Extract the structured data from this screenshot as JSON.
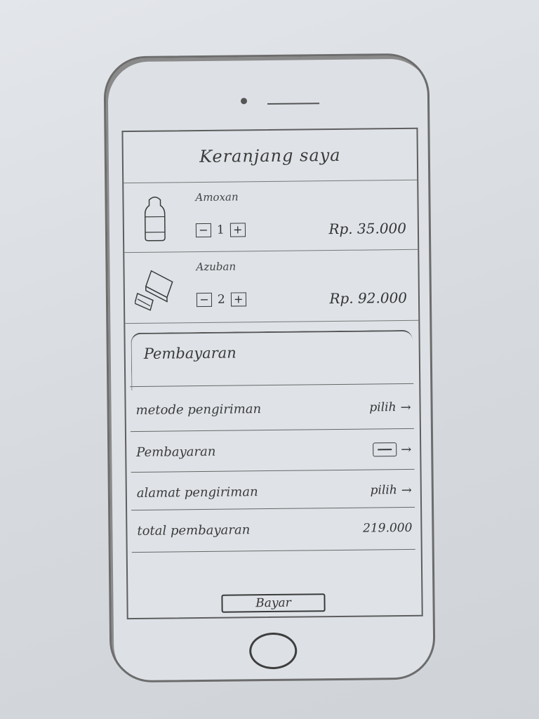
{
  "header": {
    "title": "Keranjang saya"
  },
  "cart": {
    "items": [
      {
        "name": "Amoxan",
        "qty": "1",
        "price": "Rp. 35.000",
        "icon": "medicine-bottle-icon"
      },
      {
        "name": "Azuban",
        "qty": "2",
        "price": "Rp. 92.000",
        "icon": "medicine-box-icon"
      }
    ],
    "minus_symbol": "−",
    "plus_symbol": "+"
  },
  "payment": {
    "title": "Pembayaran",
    "rows": [
      {
        "label": "metode pengiriman",
        "value": "pilih"
      },
      {
        "label": "Pembayaran",
        "value": ""
      },
      {
        "label": "alamat pengiriman",
        "value": "pilih"
      },
      {
        "label": "total pembayaran",
        "value": "219.000"
      }
    ],
    "arrow": "→"
  },
  "footer": {
    "pay_button": "Bayar"
  },
  "colors": {
    "ink": "#3a3a3a",
    "paper": "#dfe3e8"
  }
}
